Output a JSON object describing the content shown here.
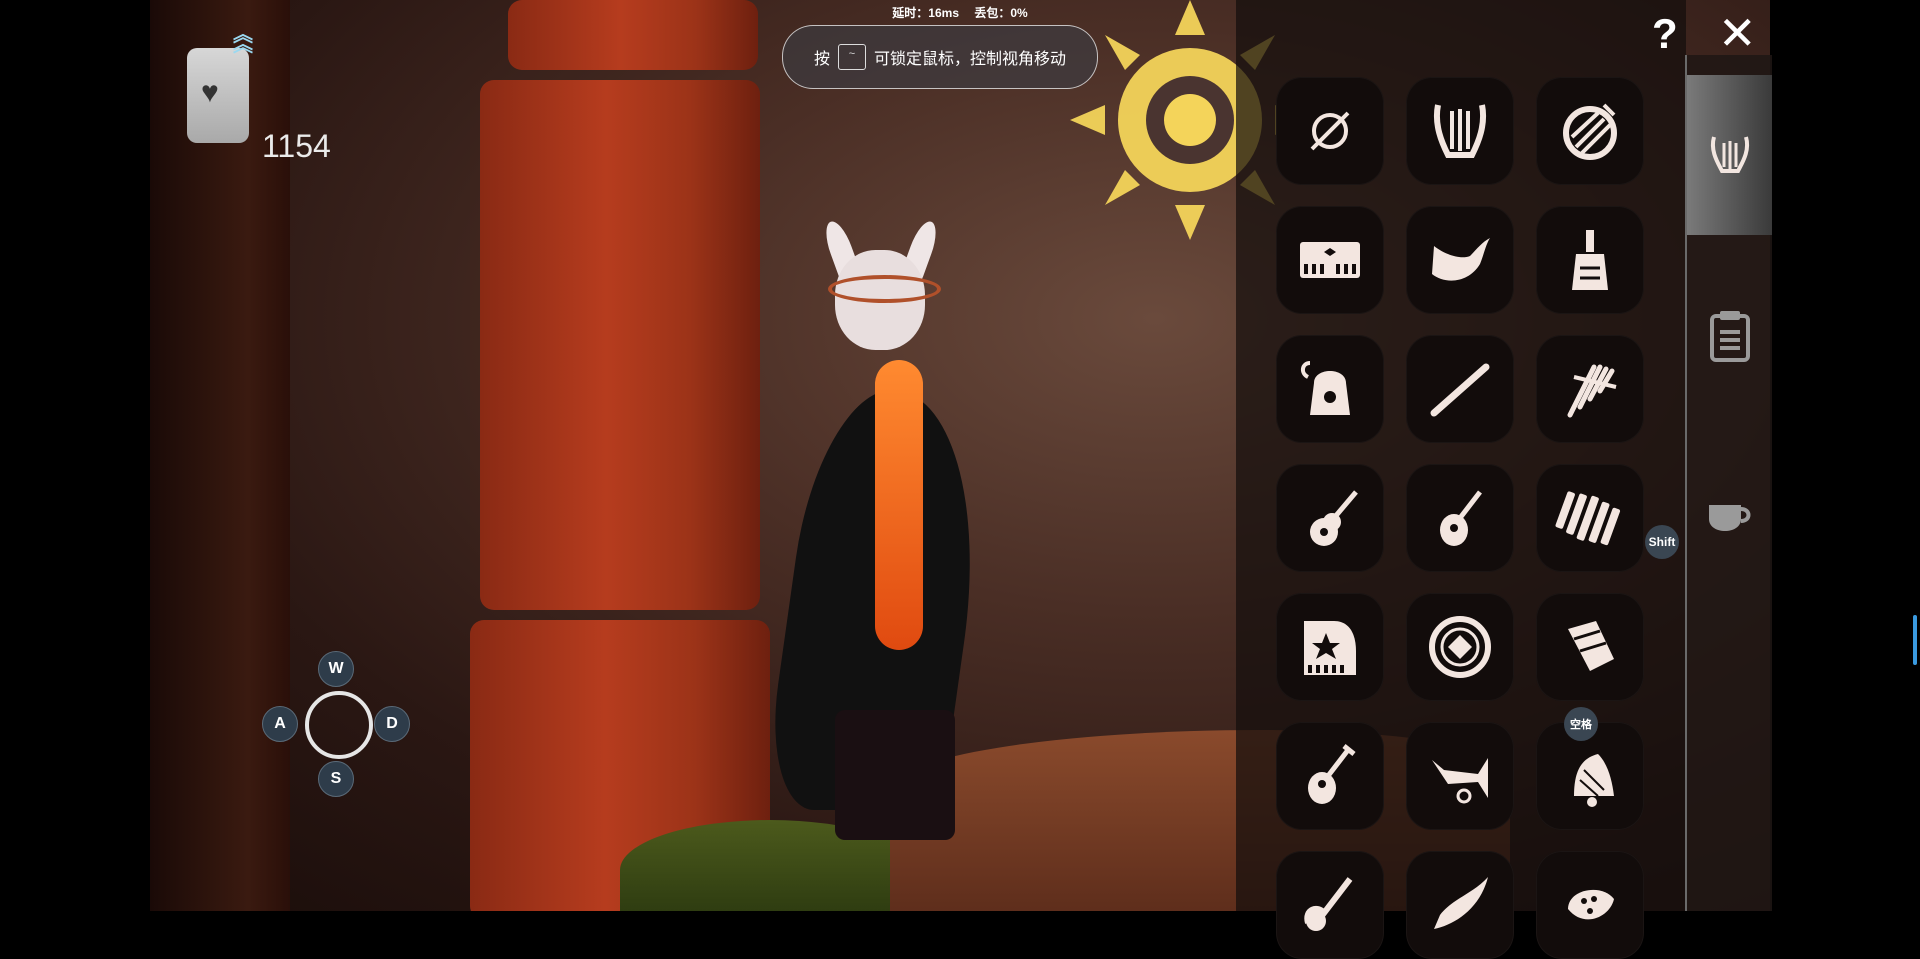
{
  "status": {
    "latency": "延时：16ms",
    "packet_loss": "丢包：0%"
  },
  "notice": {
    "prefix": "按",
    "key": "~",
    "text": "可锁定鼠标，控制视角移动"
  },
  "candle": {
    "count": "1154",
    "icon": "heart-candle-icon"
  },
  "movement_keys": {
    "up": "W",
    "left": "A",
    "right": "D",
    "down": "S"
  },
  "panel": {
    "help_label": "?",
    "close_label": "✕",
    "shift_hint": "Shift",
    "space_hint": "空格",
    "instruments": [
      "none-icon",
      "harp-icon",
      "drum-icon",
      "keyboard-icon",
      "horn-icon",
      "bell-shaker-icon",
      "oil-lamp-icon",
      "flute-icon",
      "panpipe-icon",
      "guitar-icon",
      "mandolin-icon",
      "xylophone-icon",
      "grand-piano-icon",
      "frame-drum-icon",
      "hand-drum-icon",
      "lute-icon",
      "trumpet-icon",
      "handbell-icon",
      "electric-guitar-icon",
      "leaf-icon",
      "ocarina-icon"
    ],
    "side_tabs": [
      "instruments-tab-harp-icon",
      "clipboard-icon",
      "cup-icon"
    ]
  }
}
